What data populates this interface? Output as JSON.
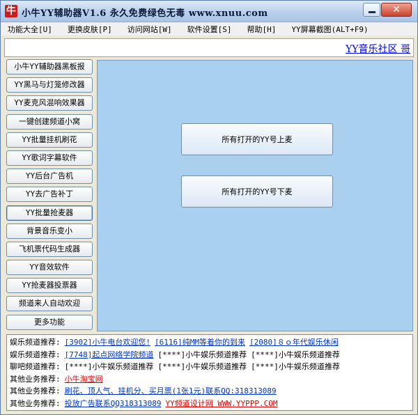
{
  "window": {
    "title": "小牛YY辅助器V1.6 永久免费绿色无毒 www.xnuu.com",
    "icon_char": "牛",
    "icon_name": "app-logo-icon",
    "close_glyph": "✕"
  },
  "menu": [
    "功能大全[U]",
    "更换皮肤[P]",
    "访问网站[W]",
    "软件设置[S]",
    "帮助[H]",
    "YY屏幕截图(ALT+F9)"
  ],
  "top_link": "YY音乐社区 哥",
  "sidebar": [
    "小牛YY辅助器黑板报",
    "YY黑马与灯笼修改器",
    "YY麦克风混响效果器",
    "一键创建频道小窝",
    "YY批量挂机刷花",
    "YY歌词字幕软件",
    "YY后台广告机",
    "YY去广告补丁",
    "YY批量抢麦器",
    "背景音乐变小",
    "飞机票代码生成器",
    "YY音效软件",
    "YY抢麦器投票器",
    "频道来人自动欢迎",
    "更多功能"
  ],
  "main": {
    "btn_up": "所有打开的YY号上麦",
    "btn_down": "所有打开的YY号下麦"
  },
  "footer": [
    {
      "label": "娱乐频道推荐:",
      "items": [
        {
          "text": "[3902]小牛电台欢迎您!",
          "style": "link"
        },
        {
          "text": "[6116]纯MM等着你的到来",
          "style": "link"
        },
        {
          "text": "[2080]８ｏ年代娱乐休闲",
          "style": "link"
        }
      ]
    },
    {
      "label": "娱乐频道推荐:",
      "items": [
        {
          "text": "[7748]起点网络学院频道",
          "style": "link"
        },
        {
          "text": "[****]小牛娱乐频道推荐",
          "style": "plain"
        },
        {
          "text": "[****]小牛娱乐频道推荐",
          "style": "plain"
        }
      ]
    },
    {
      "label": "聊吧频道推荐:",
      "items": [
        {
          "text": "[****]小牛娱乐频道推荐",
          "style": "plain"
        },
        {
          "text": "[****]小牛娱乐频道推荐",
          "style": "plain"
        },
        {
          "text": "[****]小牛娱乐频道推荐",
          "style": "plain"
        }
      ]
    },
    {
      "label": "其他业务推荐:",
      "items": [
        {
          "text": "小牛淘宝网",
          "style": "red"
        }
      ]
    },
    {
      "label": "其他业务推荐:",
      "items": [
        {
          "text": "刷花、顶人气、挂机分、买月票(1张1元)联系QQ:318313089",
          "style": "link"
        }
      ]
    },
    {
      "label": "其他业务推荐:",
      "items": [
        {
          "text": "投放广告联系QQ318313089",
          "style": "link"
        },
        {
          "text": "YY频道设计网 WWW.YYPPP.COM",
          "style": "red"
        }
      ]
    }
  ],
  "colors": {
    "main_panel": "#A9D0EF",
    "link": "#0033CC",
    "link_red": "#E00000",
    "close_button": "#C7432D"
  }
}
